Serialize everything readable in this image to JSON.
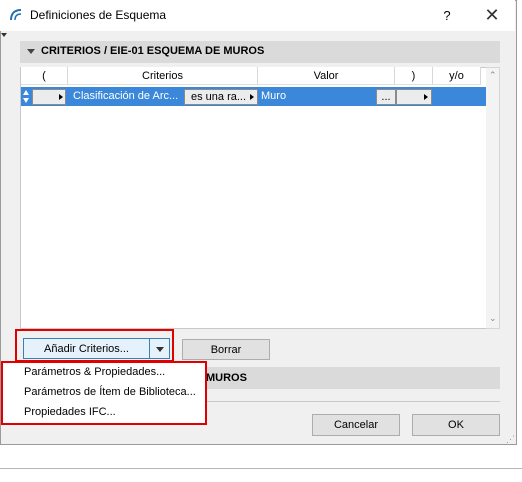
{
  "window": {
    "title": "Definiciones de Esquema",
    "help_label": "?",
    "close_label": "✕"
  },
  "criteria_section": {
    "title": "CRITERIOS / EIE-01 ESQUEMA DE MUROS",
    "columns": [
      "(",
      "Criterios",
      "Valor",
      ")",
      "y/o"
    ],
    "row": {
      "criterion": "Clasificación de Arc...",
      "operator": "es una ra...",
      "value": "Muro",
      "value_button": "..."
    }
  },
  "buttons": {
    "add_criteria": "Añadir Criterios...",
    "delete": "Borrar",
    "cancel": "Cancelar",
    "ok": "OK"
  },
  "second_section": {
    "title_fragment": "MUROS"
  },
  "dropdown_menu": {
    "items": [
      "Parámetros & Propiedades...",
      "Parámetros de Ítem de Biblioteca...",
      "Propiedades IFC..."
    ]
  },
  "colors": {
    "selection": "#3b87d9",
    "highlight_frame": "#e00000",
    "dialog_background": "#f0f0f0"
  }
}
